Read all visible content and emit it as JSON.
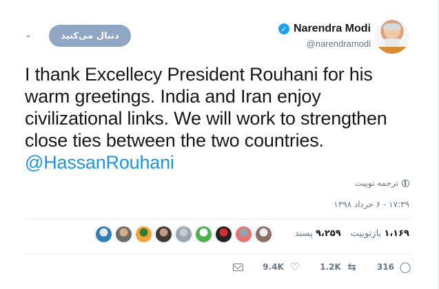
{
  "header": {
    "display_name": "Narendra Modi",
    "handle": "@narendramodi",
    "follow_label": "دنبال می‌کنید"
  },
  "tweet": {
    "lines": [
      "I thank Excellecy President Rouhani for his",
      "warm greetings. India and Iran enjoy",
      "civilizational links. We will work to strengthen",
      "close ties between the two countries."
    ],
    "mention": "@HassanRouhani",
    "translate_label": "ترجمه توییت",
    "timestamp": "۱۷:۳۹ - ۶ خرداد ۱۳۹۸"
  },
  "stats": {
    "retweets_number": "۱،۱۶۹",
    "retweets_label": "بازتوییت",
    "likes_number": "۹،۲۵۹",
    "likes_label": "پسند"
  },
  "liker_avatars": [
    {
      "colors": [
        "#2f7fb8",
        "#e8e8e8"
      ]
    },
    {
      "colors": [
        "#6b6b6b",
        "#d1b08a"
      ]
    },
    {
      "colors": [
        "#f2a33a",
        "#2e7d32"
      ]
    },
    {
      "colors": [
        "#3a3a3a",
        "#c49a7a"
      ]
    },
    {
      "colors": [
        "#9aa4ad",
        "#c7ccd1"
      ]
    },
    {
      "colors": [
        "#4caf50",
        "#ffffff"
      ]
    },
    {
      "colors": [
        "#222222",
        "#d32f2f"
      ]
    },
    {
      "colors": [
        "#e57373",
        "#90a4ae"
      ]
    },
    {
      "colors": [
        "#8d6e63",
        "#eeeeee"
      ]
    }
  ],
  "actions": {
    "replies": "316",
    "retweets": "1.2K",
    "likes": "9.4K"
  },
  "colors": {
    "link": "#1b95e0",
    "verified": "#1da1f2",
    "follow_button": "#8fa7c4",
    "muted": "#657786"
  }
}
